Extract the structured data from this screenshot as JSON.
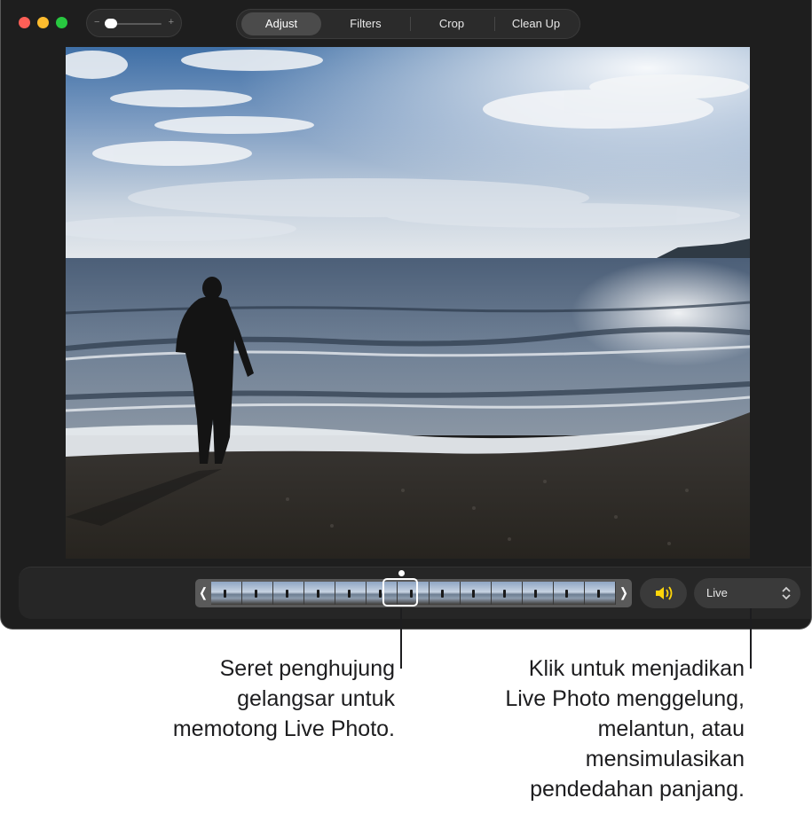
{
  "toolbar": {
    "zoom": {
      "minus": "−",
      "plus": "+"
    },
    "tabs": [
      {
        "label": "Adjust",
        "active": true
      },
      {
        "label": "Filters",
        "active": false
      },
      {
        "label": "Crop",
        "active": false
      },
      {
        "label": "Clean Up",
        "active": false
      }
    ]
  },
  "live_bar": {
    "prev_chevron": "❬",
    "next_chevron": "❭",
    "frame_count": 13,
    "sound_icon": "speaker-wave-icon",
    "sound_color": "#ffd60a",
    "effect_select": {
      "value": "Live"
    }
  },
  "annotations": {
    "left": [
      "Seret penghujung",
      "gelangsar untuk",
      "memotong Live Photo."
    ],
    "right": [
      "Klik untuk menjadikan",
      "Live Photo menggelung,",
      "melantun, atau",
      "mensimulasikan",
      "pendedahan panjang."
    ]
  }
}
